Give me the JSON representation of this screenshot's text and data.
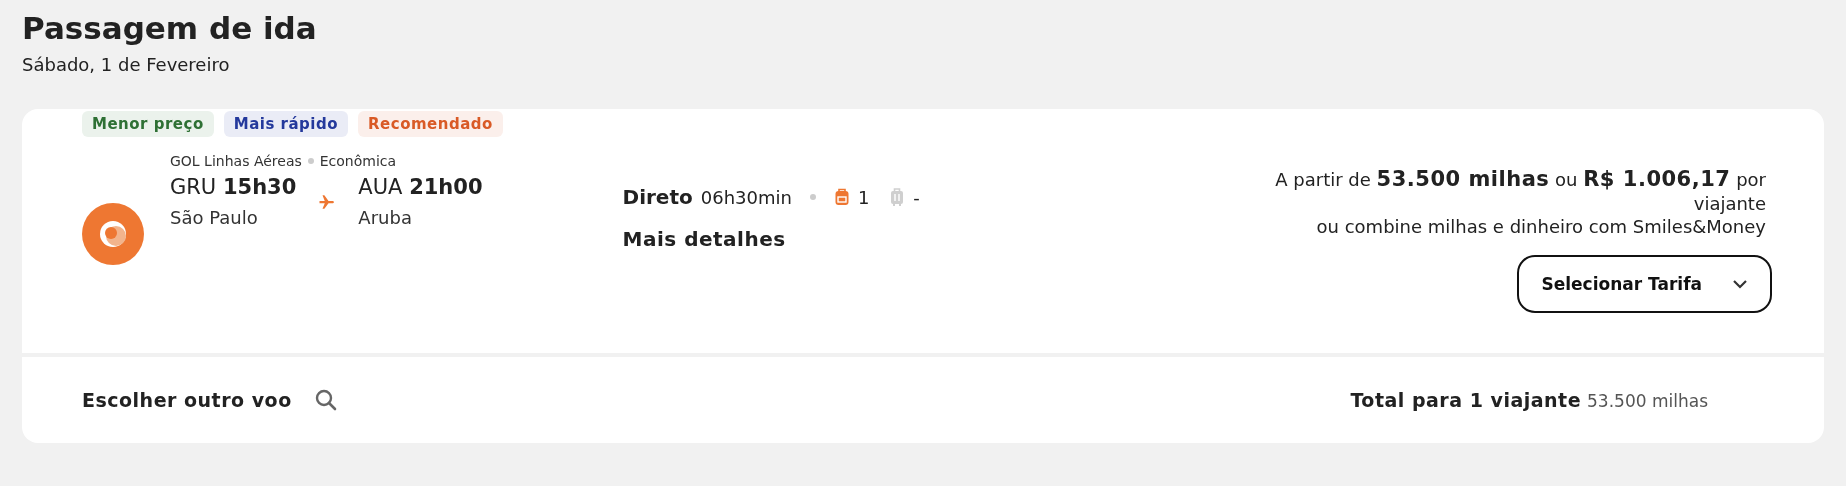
{
  "header": {
    "title": "Passagem de ida",
    "date": "Sábado, 1 de Fevereiro"
  },
  "flight": {
    "badges": [
      {
        "label": "Menor preço",
        "color": "#2e7034"
      },
      {
        "label": "Mais rápido",
        "color": "#24399c"
      },
      {
        "label": "Recomendado",
        "color": "#d95a26"
      }
    ],
    "airline": "GOL Linhas Aéreas",
    "cabin": "Econômica",
    "origin": {
      "code": "GRU",
      "time": "15h30",
      "city": "São Paulo"
    },
    "destination": {
      "code": "AUA",
      "time": "21h00",
      "city": "Aruba"
    },
    "stops": "Direto",
    "duration": "06h30min",
    "baggage": [
      {
        "kind": "carry-on",
        "count": "1",
        "included": true
      },
      {
        "kind": "checked",
        "count": "-",
        "included": false
      }
    ],
    "details_link": "Mais detalhes",
    "price": "A partir de **53.500 milhas** ou **R$ 1.006,17** por viajante",
    "combine": "ou combine milhas e dinheiro com Smiles&Money",
    "select_button": "Selecionar Tarifa"
  },
  "footer": {
    "other_flight": "Escolher outro voo",
    "total_label": "Total para 1 viajante",
    "total_value": "53.500 milhas"
  }
}
